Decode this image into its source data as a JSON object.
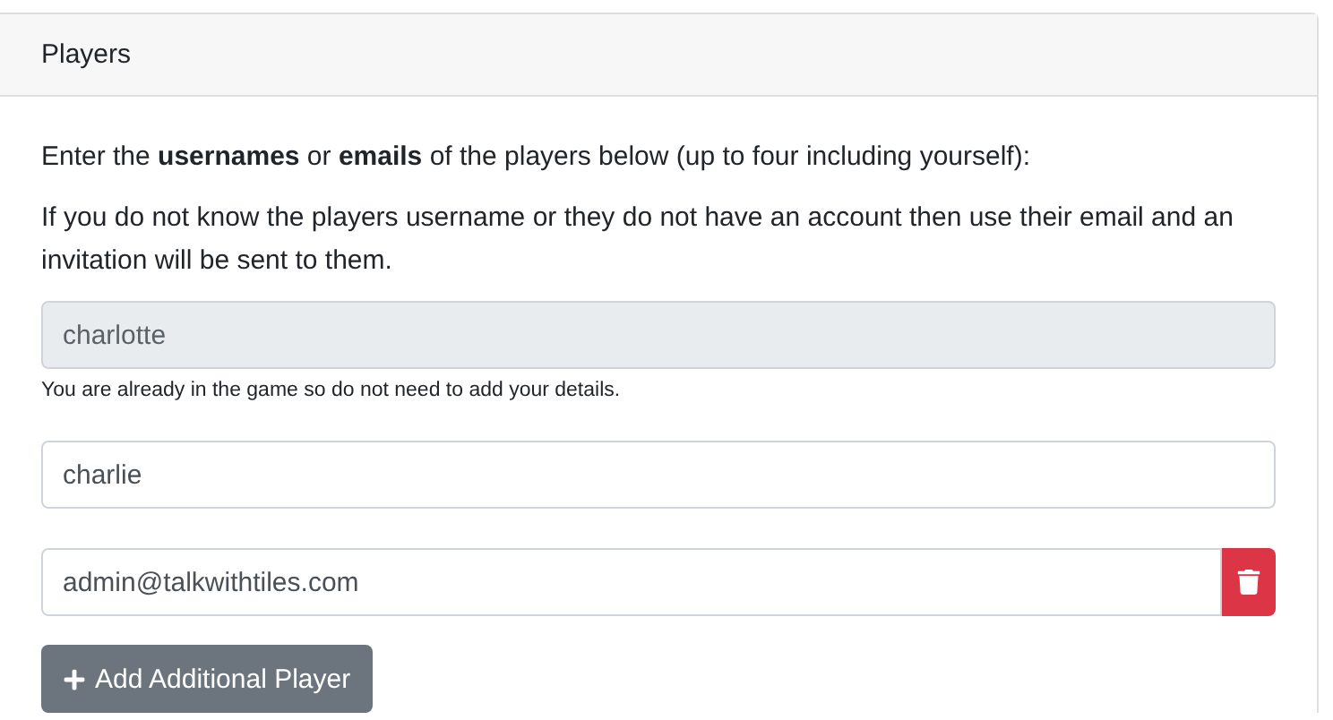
{
  "card": {
    "title": "Players"
  },
  "intro": "Enter the **usernames** or **emails** of the players below (up to four including yourself):",
  "note": "If you do not know the players username or they do not have an account then use their email and an invitation will be sent to them.",
  "players": [
    {
      "value": "charlotte",
      "disabled": true,
      "removable": false,
      "help": "You are already in the game so do not need to add your details."
    },
    {
      "value": "charlie",
      "disabled": false,
      "removable": false
    },
    {
      "value": "admin@talkwithtiles.com",
      "disabled": false,
      "removable": true
    }
  ],
  "add_button": "Add Additional Player"
}
